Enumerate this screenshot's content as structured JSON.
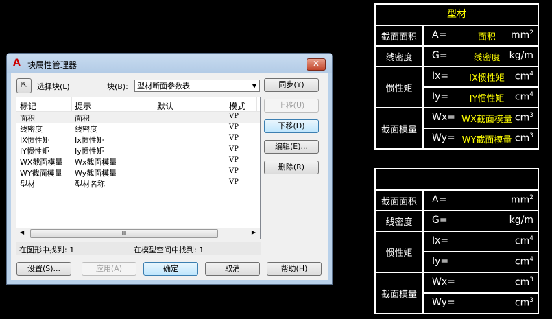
{
  "dialog": {
    "title": "块属性管理器",
    "close": "✕",
    "select_block": "选择块(L)",
    "block_label": "块(B):",
    "block_value": "型材断面参数表",
    "buttons": {
      "sync": "同步(Y)",
      "move_up": "上移(U)",
      "move_down": "下移(D)",
      "edit": "编辑(E)...",
      "delete": "删除(R)",
      "settings": "设置(S)...",
      "apply": "应用(A)",
      "ok": "确定",
      "cancel": "取消",
      "help": "帮助(H)"
    },
    "columns": [
      "标记",
      "提示",
      "默认",
      "模式"
    ],
    "rows": [
      [
        "面积",
        "面积",
        "",
        "VP"
      ],
      [
        "线密度",
        "线密度",
        "",
        "VP"
      ],
      [
        "IX惯性矩",
        "Ix惯性矩",
        "",
        "VP"
      ],
      [
        "IY惯性矩",
        "Iy惯性矩",
        "",
        "VP"
      ],
      [
        "WX截面模量",
        "Wx截面模量",
        "",
        "VP"
      ],
      [
        "WY截面模量",
        "Wy截面模量",
        "",
        "VP"
      ],
      [
        "型材",
        "型材名称",
        "",
        "VP"
      ]
    ],
    "scroll_grip": "III",
    "found_drawing": "在图形中找到: 1",
    "found_model": "在模型空间中找到: 1"
  },
  "table1": {
    "title": "型材",
    "area": "截面面积",
    "a": "A=",
    "a_val": "面积",
    "a_unit": "mm",
    "a_exp": "2",
    "density": "线密度",
    "g": "G=",
    "g_val": "线密度",
    "g_unit": "kg/m",
    "inertia": "惯性矩",
    "ix": "Ix=",
    "ix_val": "IX惯性矩",
    "iy": "Iy=",
    "iy_val": "IY惯性矩",
    "i_unit": "cm",
    "i_exp": "4",
    "modulus": "截面模量",
    "wx": "Wx=",
    "wx_val": "WX截面模量",
    "wy": "Wy=",
    "wy_val": "WY截面模量",
    "w_unit": "cm",
    "w_exp": "3"
  },
  "table2": {
    "area": "截面面积",
    "a": "A=",
    "a_unit": "mm",
    "a_exp": "2",
    "density": "线密度",
    "g": "G=",
    "g_unit": "kg/m",
    "inertia": "惯性矩",
    "ix": "Ix=",
    "iy": "Iy=",
    "i_unit": "cm",
    "i_exp": "4",
    "modulus": "截面模量",
    "wx": "Wx=",
    "wy": "Wy=",
    "w_unit": "cm",
    "w_exp": "3"
  }
}
